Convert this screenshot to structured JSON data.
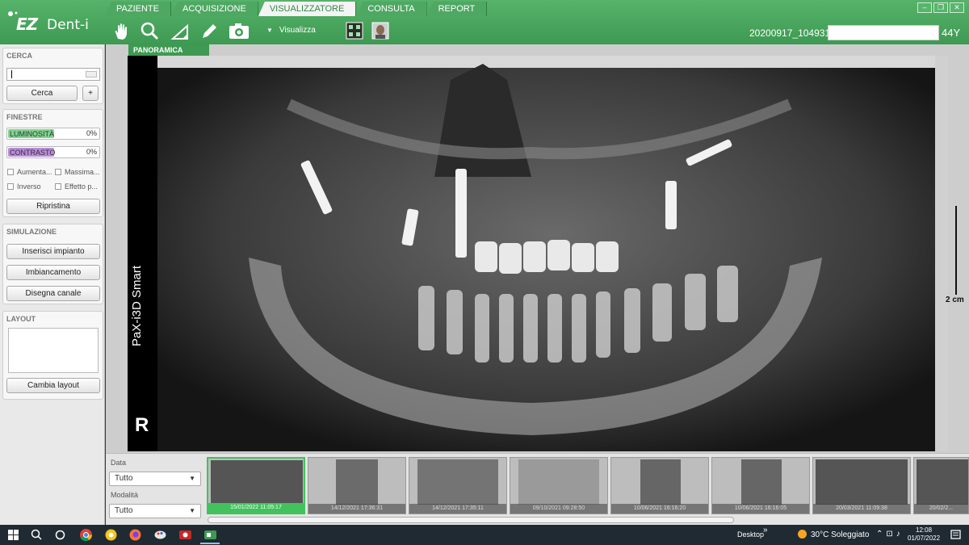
{
  "app": {
    "logo_ez": "EZ",
    "logo_dent": "Dent-i"
  },
  "tabs": [
    {
      "label": "PAZIENTE"
    },
    {
      "label": "ACQUISIZIONE"
    },
    {
      "label": "VISUALIZZATORE"
    },
    {
      "label": "CONSULTA"
    },
    {
      "label": "REPORT"
    }
  ],
  "toolbar": {
    "tools": [
      "hand-icon",
      "magnifier-icon",
      "measure-angle-icon",
      "pen-icon",
      "camera-rotate-icon"
    ],
    "view_dropdown": "Visualizza",
    "extra_tools": [
      "filter-grid-icon",
      "face-photo-icon"
    ]
  },
  "patient": {
    "id": "20200917_104931",
    "age": "44Y"
  },
  "left": {
    "search": {
      "title": "CERCA",
      "button": "Cerca",
      "plus": "+"
    },
    "windows": {
      "title": "FINESTRE",
      "brightness_label": "LUMINOSITÀ",
      "brightness_value": "0%",
      "contrast_label": "CONTRASTO",
      "contrast_value": "0%",
      "checks": [
        "Aumenta...",
        "Massima...",
        "Inverso",
        "Effetto p..."
      ],
      "reset": "Ripristina"
    },
    "simulation": {
      "title": "SIMULAZIONE",
      "buttons": [
        "Inserisci impianto",
        "Imbiancamento",
        "Disegna canale"
      ]
    },
    "layout": {
      "title": "LAYOUT",
      "button": "Cambia layout"
    }
  },
  "viewer": {
    "tab": "PANORAMICA",
    "device": "PaX-i3D Smart",
    "side": "R",
    "scale": "2 cm"
  },
  "filters": {
    "date_label": "Data",
    "date_value": "Tutto",
    "modality_label": "Modalità",
    "modality_value": "Tutto"
  },
  "thumbnails": [
    {
      "date": "15/01/2022 11:05:17"
    },
    {
      "date": "14/12/2021 17:36:31"
    },
    {
      "date": "14/12/2021 17:35:11"
    },
    {
      "date": "09/10/2021 09:28:50"
    },
    {
      "date": "10/06/2021 16:16:20"
    },
    {
      "date": "10/06/2021 16:16:05"
    },
    {
      "date": "20/03/2021 11:09:38"
    },
    {
      "date": "20/02/2..."
    }
  ],
  "taskbar": {
    "desktop": "Desktop",
    "weather": "30°C  Soleggiato",
    "time": "12:08",
    "date": "01/07/2022"
  },
  "colors": {
    "accent": "#3e9a52",
    "brightness_fill": "#7fd48e",
    "contrast_fill": "#b98bd9",
    "selected_thumb": "#41c25d"
  }
}
